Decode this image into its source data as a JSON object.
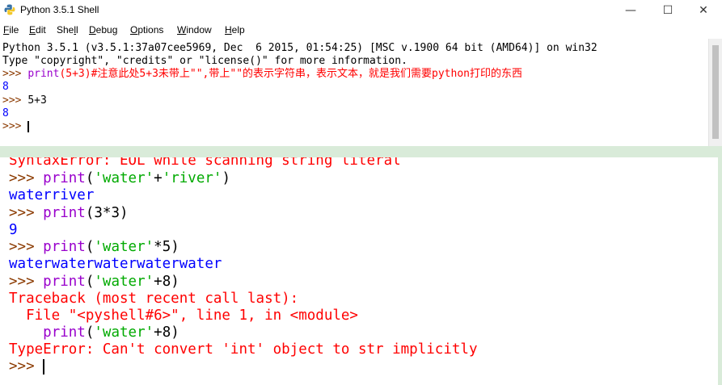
{
  "window": {
    "title": "Python 3.5.1 Shell",
    "controls": {
      "minimize": "—",
      "maximize": "☐",
      "close": "✕"
    }
  },
  "menu": [
    {
      "underline": "F",
      "rest": "ile"
    },
    {
      "underline": "E",
      "rest": "dit"
    },
    {
      "pre": "She",
      "underline": "l",
      "rest": "l"
    },
    {
      "underline": "D",
      "rest": "ebug"
    },
    {
      "underline": "O",
      "rest": "ptions"
    },
    {
      "underline": "W",
      "rest": "indow"
    },
    {
      "underline": "H",
      "rest": "elp"
    }
  ],
  "top_shell": {
    "banner1": "Python 3.5.1 (v3.5.1:37a07cee5969, Dec  6 2015, 01:54:25) [MSC v.1900 64 bit (AMD64)] on win32",
    "banner2": "Type \"copyright\", \"credits\" or \"license()\" for more information.",
    "prompt": ">>> ",
    "cmd1_kw": "print",
    "cmd1_rest": "(5+3)#注意此处5+3未带上\"\",带上\"\"的表示字符串，表示文本，就是我们需要python打印的东西",
    "out1": "8",
    "cmd2": "5+3",
    "out2": "8"
  },
  "bottom_shell": {
    "cut_error": "SyntaxError: EOL while scanning string literal",
    "prompt": ">>> ",
    "kw": "print",
    "l1_a": "(",
    "l1_s1": "'water'",
    "l1_b": "+",
    "l1_s2": "'river'",
    "l1_c": ")",
    "out1": "waterriver",
    "l2_args": "(3*3)",
    "out2": "9",
    "l3_a": "(",
    "l3_s": "'water'",
    "l3_b": "*5)",
    "out3": "waterwaterwaterwaterwater",
    "l4_a": "(",
    "l4_s": "'water'",
    "l4_b": "+8)",
    "tb1": "Traceback (most recent call last):",
    "tb2": "  File \"<pyshell#6>\", line 1, in <module>",
    "tb3_indent": "    ",
    "tb3_a": "(",
    "tb3_s": "'water'",
    "tb3_b": "+8)",
    "tb4": "TypeError: Can't convert 'int' object to str implicitly"
  },
  "colors": {
    "output": "#0000ff",
    "error": "#ff0000",
    "prompt": "#8b3a00",
    "keyword": "#9900cc",
    "string": "#00aa00"
  }
}
